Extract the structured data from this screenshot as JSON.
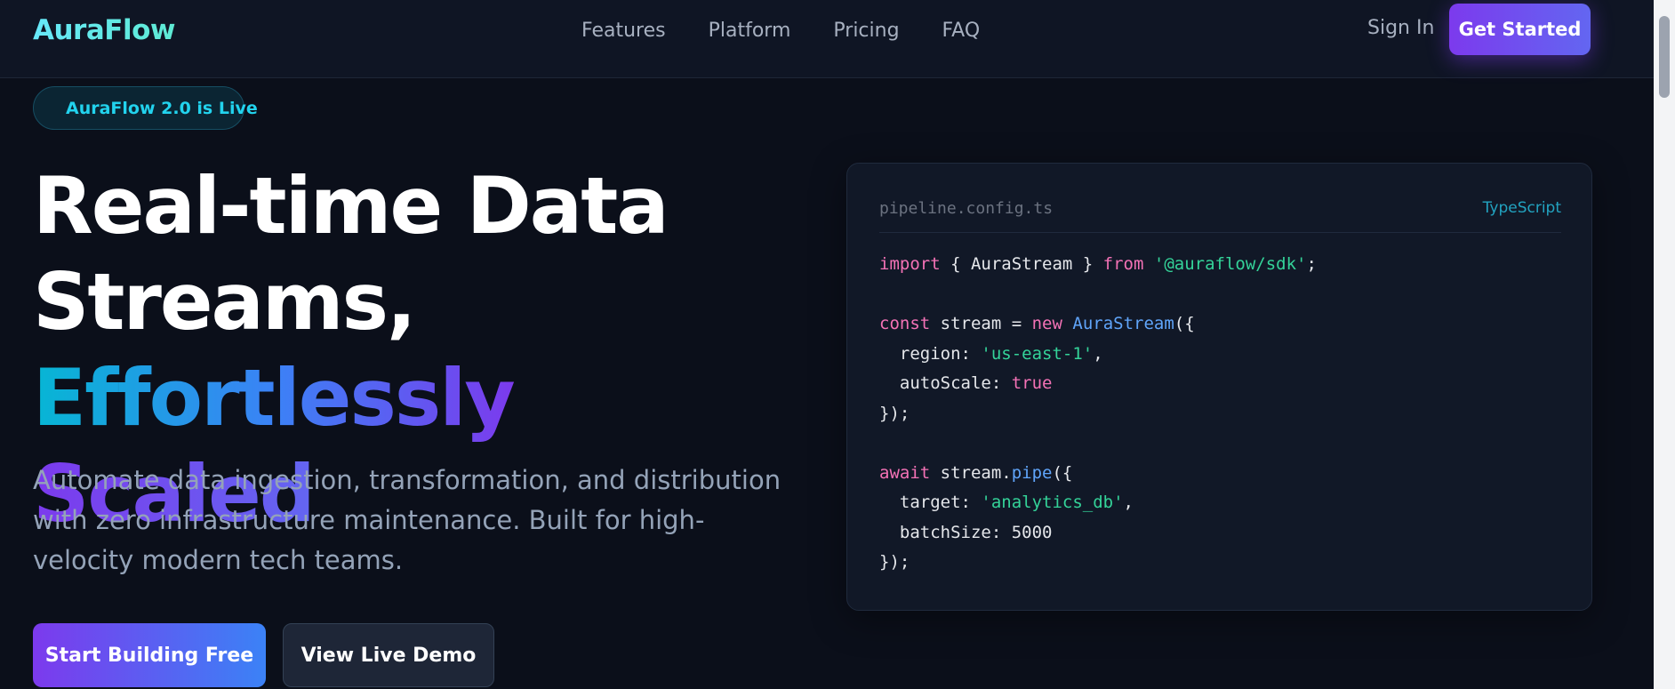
{
  "nav": {
    "logo": "AuraFlow",
    "links": [
      "Features",
      "Platform",
      "Pricing",
      "FAQ"
    ],
    "sign_in": "Sign In",
    "get_started": "Get Started"
  },
  "badge": {
    "text": "AuraFlow 2.0 is Live"
  },
  "hero": {
    "title_line1": "Real-time Data",
    "title_line2_plain": "Streams, ",
    "title_line2_grad": "Effortlessly",
    "title_line3_grad": "Scaled",
    "description": "Automate data ingestion, transformation, and distribution with zero infrastructure maintenance. Built for high-velocity modern tech teams.",
    "primary_cta": "Start Building Free",
    "secondary_cta": "View Live Demo"
  },
  "code": {
    "filename": "pipeline.config.ts",
    "language": "TypeScript",
    "lines": [
      [
        [
          "kw",
          "import"
        ],
        [
          "p",
          " { AuraStream } "
        ],
        [
          "kw",
          "from"
        ],
        [
          "p",
          " "
        ],
        [
          "str",
          "'@auraflow/sdk'"
        ],
        [
          "p",
          ";"
        ]
      ],
      [],
      [
        [
          "kw",
          "const"
        ],
        [
          "p",
          " stream = "
        ],
        [
          "kw",
          "new"
        ],
        [
          "p",
          " "
        ],
        [
          "cls",
          "AuraStream"
        ],
        [
          "p",
          "({"
        ]
      ],
      [
        [
          "p",
          "  region: "
        ],
        [
          "str",
          "'us-east-1'"
        ],
        [
          "p",
          ","
        ]
      ],
      [
        [
          "p",
          "  autoScale: "
        ],
        [
          "bool",
          "true"
        ]
      ],
      [
        [
          "p",
          "});"
        ]
      ],
      [],
      [
        [
          "kw",
          "await"
        ],
        [
          "p",
          " stream."
        ],
        [
          "fn",
          "pipe"
        ],
        [
          "p",
          "({"
        ]
      ],
      [
        [
          "p",
          "  target: "
        ],
        [
          "str",
          "'analytics_db'"
        ],
        [
          "p",
          ","
        ]
      ],
      [
        [
          "p",
          "  batchSize: 5000"
        ]
      ],
      [
        [
          "p",
          "});"
        ]
      ]
    ]
  },
  "colors": {
    "background": "#0b0f1a",
    "accent_purple": "#7c3aed",
    "accent_cyan": "#22d3ee"
  }
}
